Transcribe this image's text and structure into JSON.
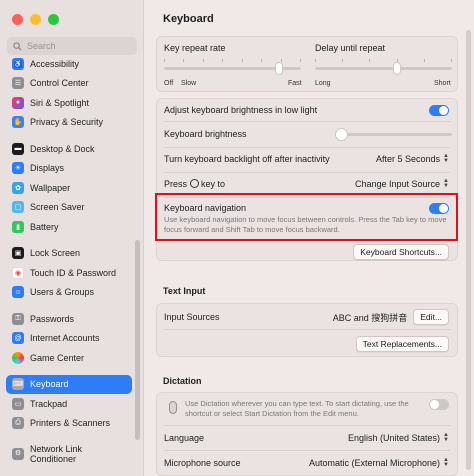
{
  "sidebar": {
    "search_placeholder": "Search",
    "items": [
      {
        "label": "Accessibility",
        "color": "#2f7df6"
      },
      {
        "label": "Control Center",
        "color": "#8e8e93"
      },
      {
        "label": "Siri & Spotlight",
        "color": "#b44ad6"
      },
      {
        "label": "Privacy & Security",
        "color": "#3b82f6"
      },
      {
        "label": "Desktop & Dock",
        "color": "#1c1c1e"
      },
      {
        "label": "Displays",
        "color": "#2f7df6"
      },
      {
        "label": "Wallpaper",
        "color": "#38a4e8"
      },
      {
        "label": "Screen Saver",
        "color": "#4fb9e8"
      },
      {
        "label": "Battery",
        "color": "#34c759"
      },
      {
        "label": "Lock Screen",
        "color": "#1c1c1e"
      },
      {
        "label": "Touch ID & Password",
        "color": "#ff3b30"
      },
      {
        "label": "Users & Groups",
        "color": "#2f7df6"
      },
      {
        "label": "Passwords",
        "color": "#8e8e93"
      },
      {
        "label": "Internet Accounts",
        "color": "#2f7df6"
      },
      {
        "label": "Game Center",
        "color": "#ff9500"
      },
      {
        "label": "Keyboard",
        "color": "#8e8e93"
      },
      {
        "label": "Trackpad",
        "color": "#8e8e93"
      },
      {
        "label": "Printers & Scanners",
        "color": "#8e8e93"
      },
      {
        "label": "Network Link Conditioner",
        "color": "#8e8e93"
      }
    ]
  },
  "page": {
    "title": "Keyboard"
  },
  "repeat": {
    "key_repeat_label": "Key repeat rate",
    "delay_label": "Delay until repeat",
    "off": "Off",
    "slow": "Slow",
    "fast": "Fast",
    "long": "Long",
    "short": "Short"
  },
  "settings": {
    "adjust_brightness": "Adjust keyboard brightness in low light",
    "keyboard_brightness": "Keyboard brightness",
    "backlight_off": "Turn keyboard backlight off after inactivity",
    "backlight_value": "After 5 Seconds",
    "press_key_prefix": "Press",
    "press_key_suffix": "key to",
    "press_key_value": "Change Input Source",
    "kbd_nav_title": "Keyboard navigation",
    "kbd_nav_desc": "Use keyboard navigation to move focus between controls. Press the Tab key to move focus forward and Shift Tab to move focus backward.",
    "shortcuts_button": "Keyboard Shortcuts..."
  },
  "text_input": {
    "section": "Text Input",
    "input_sources": "Input Sources",
    "input_value": "ABC and 搜狗拼音",
    "edit_button": "Edit...",
    "replacements_button": "Text Replacements..."
  },
  "dictation": {
    "section": "Dictation",
    "desc": "Use Dictation wherever you can type text. To start dictating, use the shortcut or select Start Dictation from the Edit menu.",
    "language_label": "Language",
    "language_value": "English (United States)",
    "mic_label": "Microphone source",
    "mic_value": "Automatic (External Microphone)"
  }
}
